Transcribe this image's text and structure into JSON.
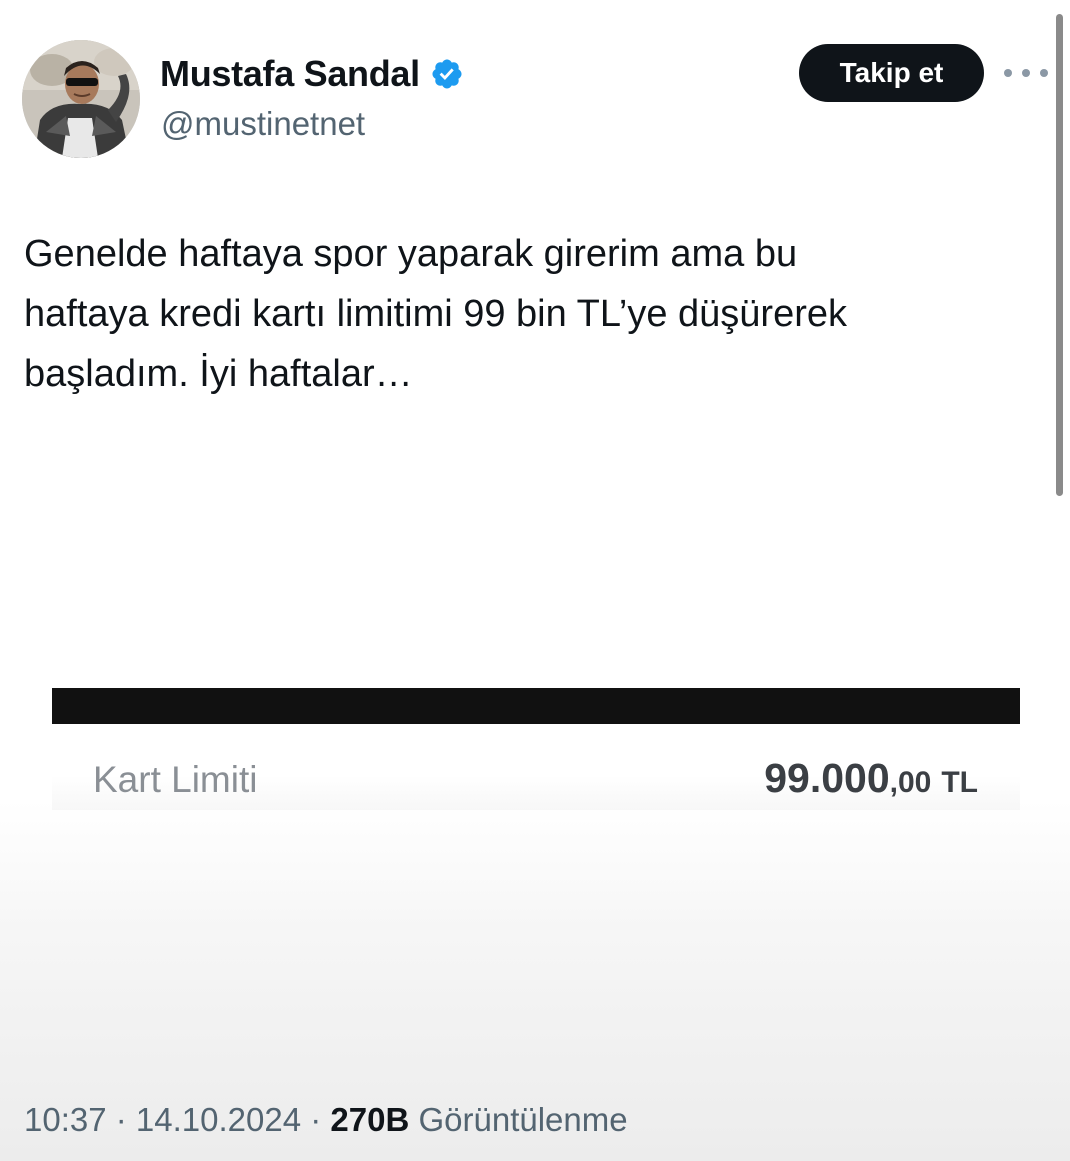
{
  "author": {
    "display_name": "Mustafa Sandal",
    "handle": "@mustinetnet",
    "verified": true,
    "avatar_icon": "profile-photo",
    "verified_icon": "verified-badge-icon",
    "verified_color": "#1d9bf0"
  },
  "header": {
    "follow_label": "Takip et",
    "more_icon": "more-horizontal-icon"
  },
  "tweet": {
    "text": "Genelde haftaya spor yaparak girerim ama bu\nhaftaya kredi kartı limitimi 99 bin TL’ye düşürerek\nbaşladım. İyi haftalar…"
  },
  "attachment": {
    "label": "Kart Limiti",
    "amount_main": "99.000",
    "amount_cents": ",00",
    "currency": "TL"
  },
  "meta": {
    "time": "10:37",
    "separator_1": " · ",
    "date": "14.10.2024",
    "separator_2": " · ",
    "views_count": "270B",
    "views_label": " Görüntülenme"
  },
  "colors": {
    "text_primary": "#0f1419",
    "text_secondary": "#536471",
    "button_bg": "#0f1419",
    "button_text": "#ffffff"
  }
}
